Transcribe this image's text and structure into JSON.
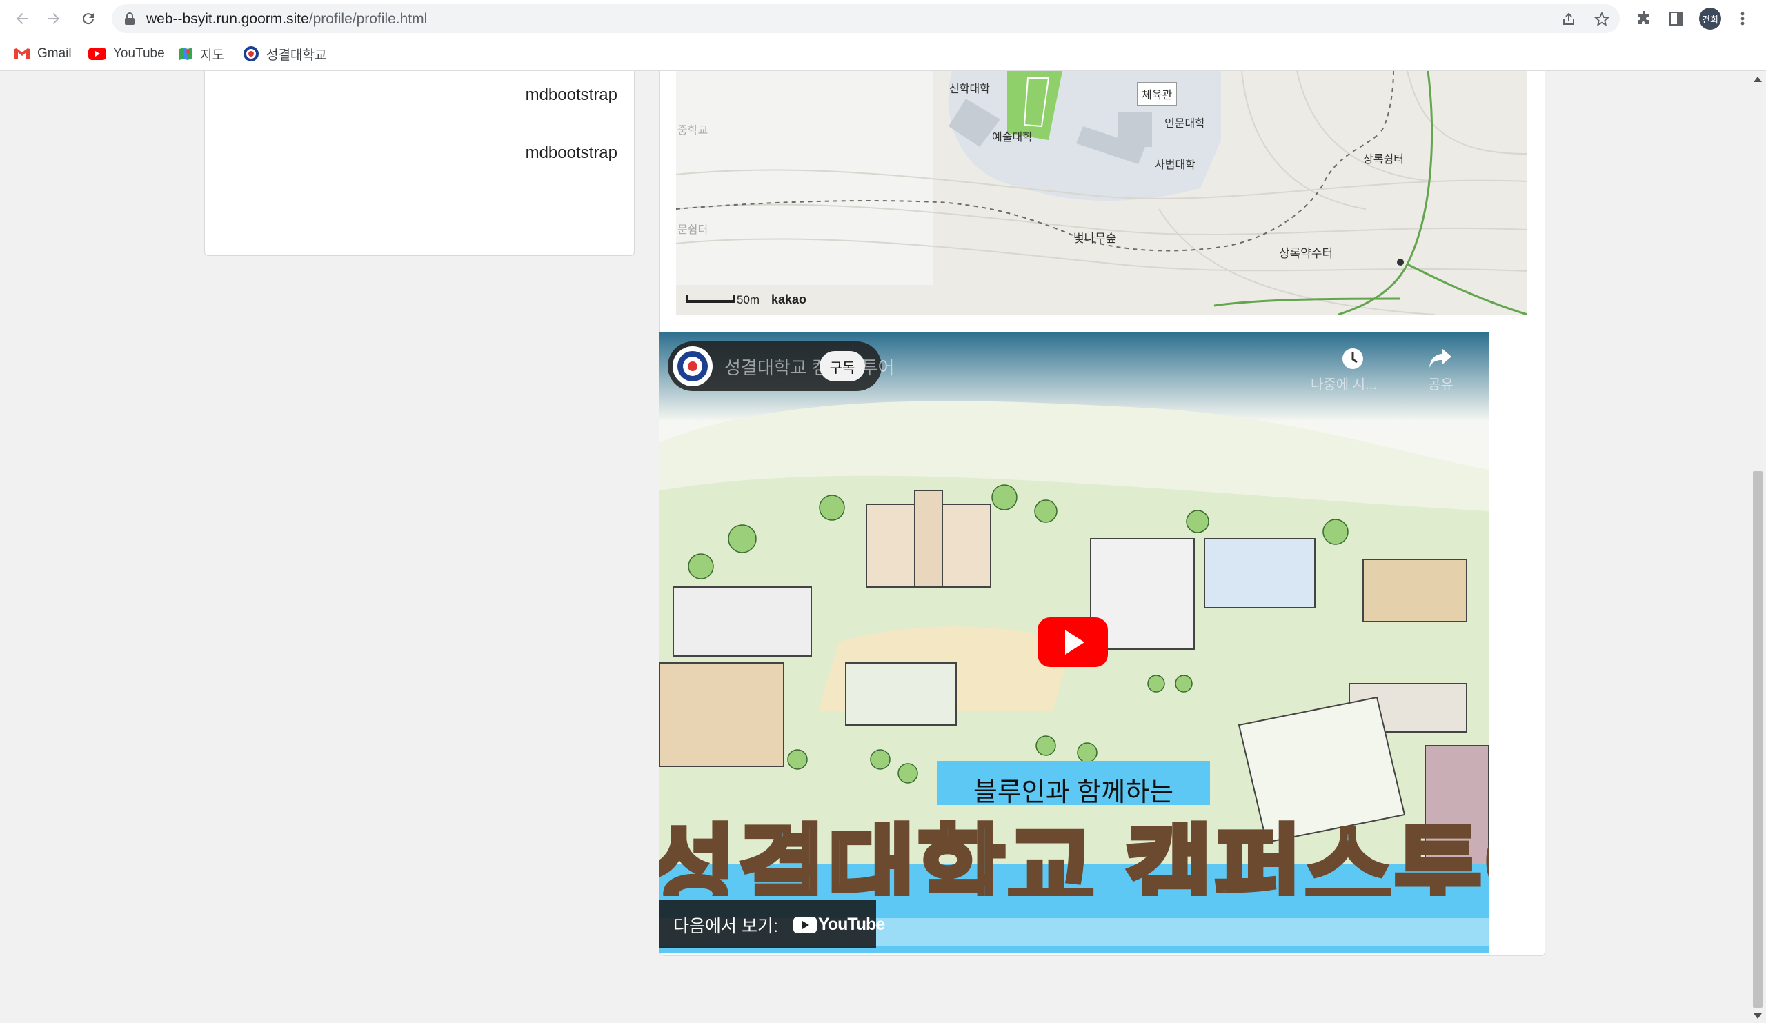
{
  "browser": {
    "url_host": "web--bsyit.run.goorm.site",
    "url_path": "/profile/profile.html",
    "avatar_text": "건희"
  },
  "bookmarks": [
    {
      "label": "Gmail",
      "icon": "gmail-icon"
    },
    {
      "label": "YouTube",
      "icon": "youtube-icon"
    },
    {
      "label": "지도",
      "icon": "maps-icon"
    },
    {
      "label": "성결대학교",
      "icon": "university-icon"
    }
  ],
  "list": {
    "items": [
      "mdbootstrap",
      "mdbootstrap"
    ]
  },
  "map": {
    "labels": {
      "theology": "신학대학",
      "gym": "체육관",
      "humanities": "인문대학",
      "arts": "예술대학",
      "education": "사범대학",
      "rest_area": "상록쉼터",
      "cherry_forest": "벚나무숲",
      "spring": "상록약수터",
      "school_left": "중학교",
      "rest_left": "문쉼터"
    },
    "scale": "50m",
    "brand": "kakao"
  },
  "video": {
    "title": "성결대학교 캠퍼스투어",
    "subscribe": "구독",
    "watch_later": "나중에 시...",
    "share": "공유",
    "banner": "블루인과 함께하는",
    "headline": "성결대학교 캠퍼스투어",
    "watch_on": "다음에서 보기:",
    "youtube": "YouTube"
  },
  "colors": {
    "accent_blue": "#5ec8f5",
    "youtube_red": "#ff0000"
  }
}
